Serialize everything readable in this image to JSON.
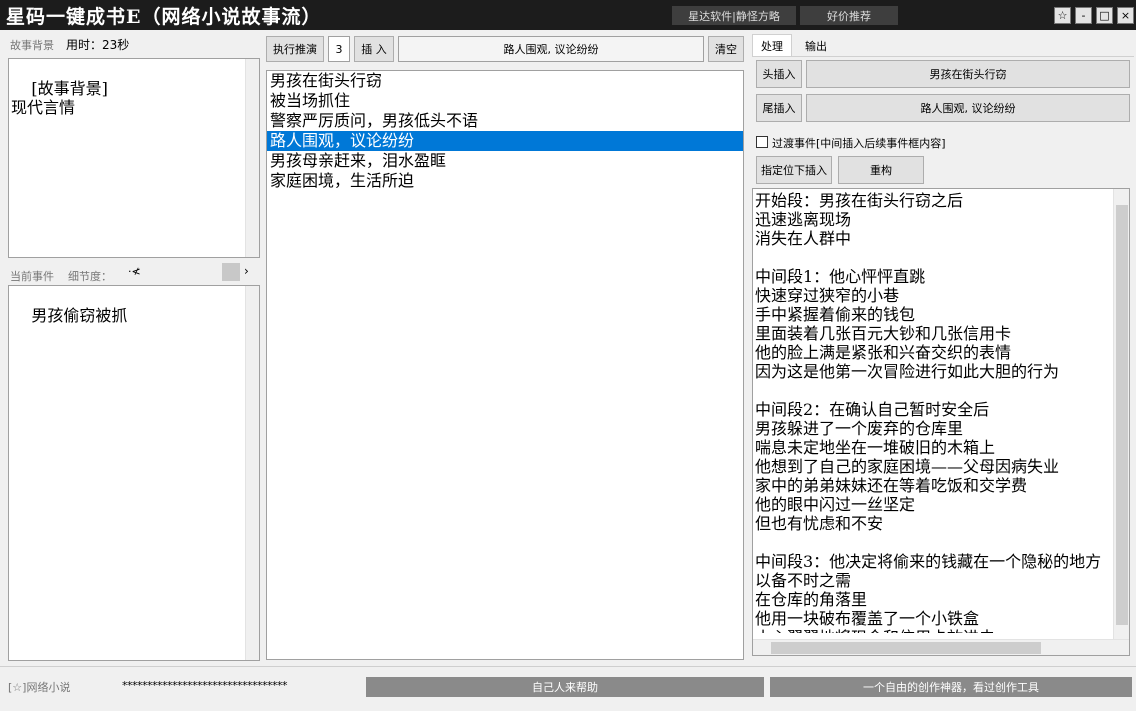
{
  "window": {
    "title": "星码一键成书E（网络小说故事流）",
    "top_buttons": [
      "星达软件|静怪方略",
      "好价推荐"
    ],
    "controls": {
      "pin": "☆",
      "minimize": "-",
      "maximize": "□",
      "close": "×"
    }
  },
  "left": {
    "background_label": "故事背景",
    "time_label": "用时：23秒",
    "background_text": "[故事背景]\n现代言情",
    "current_event_label": "当前事件",
    "detail_label": "细节度：",
    "slider_char": "·≮",
    "current_event_text": "男孩偷窃被抓"
  },
  "middle": {
    "execute_button": "执行推演",
    "count_value": "3",
    "insert_button": "插 入",
    "insert_text": "路人围观, 议论纷纷",
    "clear_button": "清空",
    "events": [
      "男孩在街头行窃",
      "被当场抓住",
      "警察严厉质问，男孩低头不语",
      "路人围观，议论纷纷",
      "男孩母亲赶来，泪水盈眶",
      "家庭困境，生活所迫"
    ],
    "selected_index": 3
  },
  "right": {
    "tabs": [
      "处理",
      "输出"
    ],
    "head_insert_button": "头插入",
    "head_insert_value": "男孩在街头行窃",
    "tail_insert_button": "尾插入",
    "tail_insert_value": "路人围观, 议论纷纷",
    "transition_checkbox_label": "过渡事件[中间插入后续事件框内容]",
    "insert_below_button": "指定位下插入",
    "rebuild_button": "重构",
    "output_lines": [
      "开始段：男孩在街头行窃之后",
      "迅速逃离现场",
      "消失在人群中",
      "",
      "中间段1：他心怦怦直跳",
      "快速穿过狭窄的小巷",
      "手中紧握着偷来的钱包",
      "里面装着几张百元大钞和几张信用卡",
      "他的脸上满是紧张和兴奋交织的表情",
      "因为这是他第一次冒险进行如此大胆的行为",
      "",
      "中间段2：在确认自己暂时安全后",
      "男孩躲进了一个废弃的仓库里",
      "喘息未定地坐在一堆破旧的木箱上",
      "他想到了自己的家庭困境——父母因病失业",
      "家中的弟弟妹妹还在等着吃饭和交学费",
      "他的眼中闪过一丝坚定",
      "但也有忧虑和不安",
      "",
      "中间段3：他决定将偷来的钱藏在一个隐秘的地方",
      "以备不时之需",
      "在仓库的角落里",
      "他用一块破布覆盖了一个小铁盒",
      "小心翼翼地将现金和信用卡放进去"
    ]
  },
  "status": {
    "left_text": "[☆]网络小说",
    "masked_key": "*********************************",
    "button_1": "自己人来帮助",
    "button_2": "一个自由的创作神器，看过创作工具"
  }
}
